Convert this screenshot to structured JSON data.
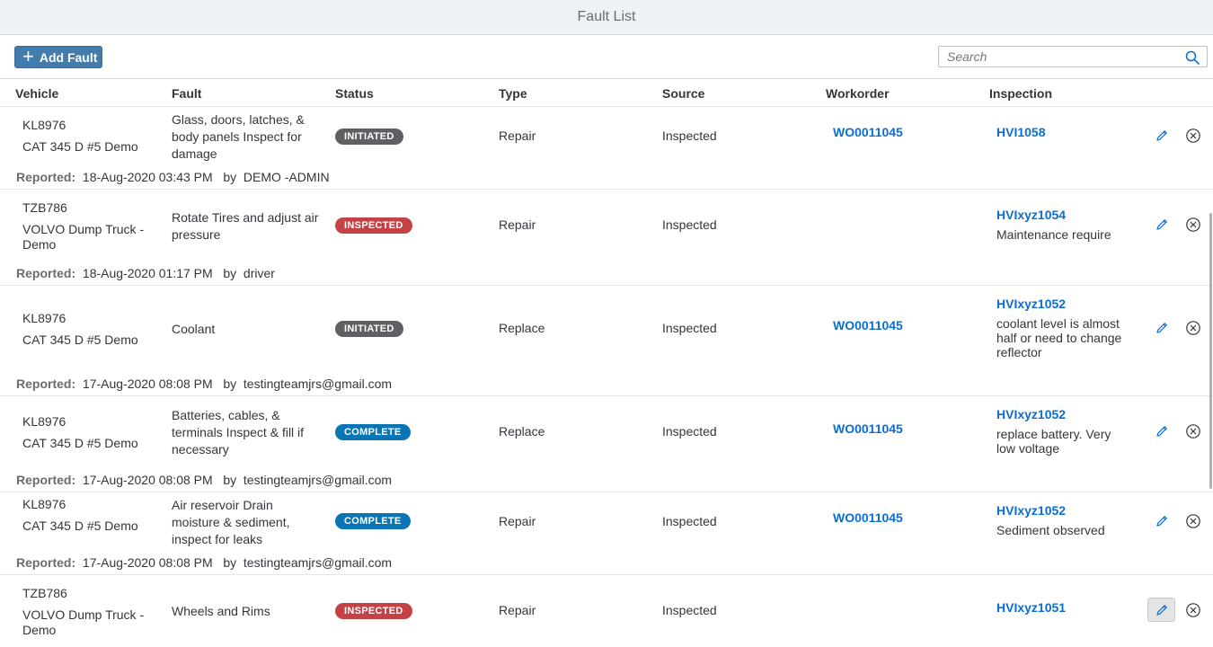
{
  "window": {
    "title": "Fault List"
  },
  "toolbar": {
    "add_label": "Add Fault",
    "search_placeholder": "Search"
  },
  "columns": [
    "Vehicle",
    "Fault",
    "Status",
    "Type",
    "Source",
    "Workorder",
    "Inspection"
  ],
  "reported_label": "Reported:",
  "by_label": "by",
  "rows": [
    {
      "vehicle_id": "KL8976",
      "vehicle_name": "CAT 345 D #5 Demo",
      "fault": "Glass, doors, latches, & body panels Inspect for damage",
      "status": "INITIATED",
      "type": "Repair",
      "source": "Inspected",
      "workorder": "WO0011045",
      "inspection": "HVI1058",
      "inspection_note": "",
      "reported_at": "18-Aug-2020 03:43 PM",
      "reported_by": "DEMO -ADMIN"
    },
    {
      "vehicle_id": "TZB786",
      "vehicle_name": "VOLVO Dump Truck - Demo",
      "fault": "Rotate Tires and adjust air pressure",
      "status": "INSPECTED",
      "type": "Repair",
      "source": "Inspected",
      "workorder": "",
      "inspection": "HVIxyz1054",
      "inspection_note": "Maintenance require",
      "reported_at": "18-Aug-2020 01:17 PM",
      "reported_by": "driver"
    },
    {
      "vehicle_id": "KL8976",
      "vehicle_name": "CAT 345 D #5 Demo",
      "fault": "Coolant",
      "status": "INITIATED",
      "type": "Replace",
      "source": "Inspected",
      "workorder": "WO0011045",
      "inspection": "HVIxyz1052",
      "inspection_note": "coolant level is almost half or need to change reflector",
      "reported_at": "17-Aug-2020 08:08 PM",
      "reported_by": "testingteamjrs@gmail.com"
    },
    {
      "vehicle_id": "KL8976",
      "vehicle_name": "CAT 345 D #5 Demo",
      "fault": "Batteries, cables, & terminals Inspect & fill if necessary",
      "status": "COMPLETE",
      "type": "Replace",
      "source": "Inspected",
      "workorder": "WO0011045",
      "inspection": "HVIxyz1052",
      "inspection_note": "replace battery. Very low voltage",
      "reported_at": "17-Aug-2020 08:08 PM",
      "reported_by": "testingteamjrs@gmail.com"
    },
    {
      "vehicle_id": "KL8976",
      "vehicle_name": "CAT 345 D #5 Demo",
      "fault": "Air reservoir Drain moisture & sediment, inspect for leaks",
      "status": "COMPLETE",
      "type": "Repair",
      "source": "Inspected",
      "workorder": "WO0011045",
      "inspection": "HVIxyz1052",
      "inspection_note": "Sediment observed",
      "reported_at": "17-Aug-2020 08:08 PM",
      "reported_by": "testingteamjrs@gmail.com"
    },
    {
      "vehicle_id": "TZB786",
      "vehicle_name": "VOLVO Dump Truck - Demo",
      "fault": "Wheels and Rims",
      "status": "INSPECTED",
      "type": "Repair",
      "source": "Inspected",
      "workorder": "",
      "inspection": "HVIxyz1051",
      "inspection_note": "",
      "reported_at": "",
      "reported_by": ""
    }
  ],
  "status_colors": {
    "INITIATED": "#5e6063",
    "INSPECTED": "#c44145",
    "COMPLETE": "#0a75b5"
  },
  "icons": {
    "add": "plus-icon",
    "search": "search-icon",
    "edit": "pencil-icon",
    "delete": "circle-x-icon"
  }
}
